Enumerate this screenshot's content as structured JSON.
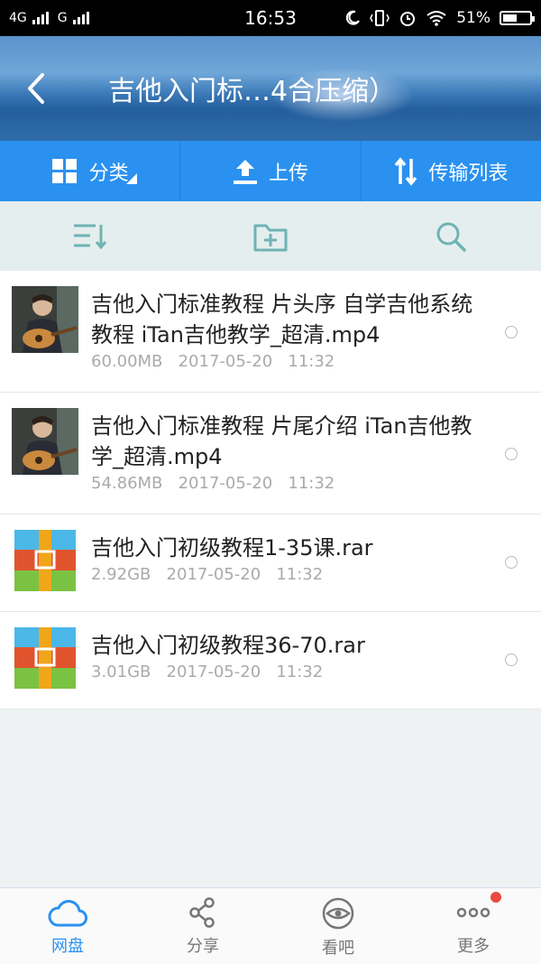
{
  "status_bar": {
    "network1": "4G",
    "network2": "G",
    "time": "16:53",
    "battery": "51%"
  },
  "header": {
    "title": "吉他入门标…4合压缩）"
  },
  "toolbar": {
    "category_label": "分类",
    "upload_label": "上传",
    "transfer_label": "传输列表"
  },
  "files": [
    {
      "name": "吉他入门标准教程 片头序 自学吉他系统教程 iTan吉他教学_超清.mp4",
      "size": "60.00MB",
      "date": "2017-05-20",
      "time": "11:32",
      "type": "video"
    },
    {
      "name": "吉他入门标准教程 片尾介绍 iTan吉他教学_超清.mp4",
      "size": "54.86MB",
      "date": "2017-05-20",
      "time": "11:32",
      "type": "video"
    },
    {
      "name": "吉他入门初级教程1-35课.rar",
      "size": "2.92GB",
      "date": "2017-05-20",
      "time": "11:32",
      "type": "archive"
    },
    {
      "name": "吉他入门初级教程36-70.rar",
      "size": "3.01GB",
      "date": "2017-05-20",
      "time": "11:32",
      "type": "archive"
    }
  ],
  "bottom_nav": {
    "items": [
      {
        "label": "网盘",
        "icon": "cloud-icon"
      },
      {
        "label": "分享",
        "icon": "share-icon"
      },
      {
        "label": "看吧",
        "icon": "eye-icon"
      },
      {
        "label": "更多",
        "icon": "more-icon"
      }
    ]
  },
  "colors": {
    "accent": "#2a91f0",
    "notification": "#e84a3e"
  }
}
